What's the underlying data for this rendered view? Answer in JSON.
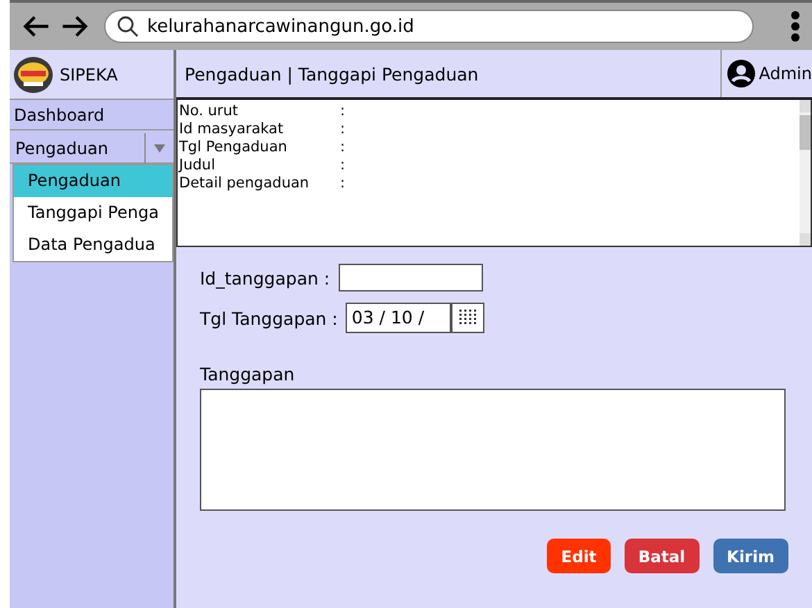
{
  "browser": {
    "url": "kelurahanarcawinangun.go.id"
  },
  "header": {
    "app_name": "SIPEKA",
    "page_title": "Pengaduan | Tanggapi Pengaduan",
    "user": "Admin"
  },
  "sidebar": {
    "items": [
      {
        "label": "Dashboard",
        "kind": "link"
      },
      {
        "label": "Pengaduan",
        "kind": "dropdown",
        "expanded": true,
        "children": [
          {
            "label": "Pengaduan",
            "selected": true
          },
          {
            "label": "Tanggapi Penga",
            "selected": false
          },
          {
            "label": "Data Pengadua",
            "selected": false
          }
        ]
      }
    ]
  },
  "detail": {
    "fields": [
      {
        "label": "No. urut"
      },
      {
        "label": "Id masyarakat"
      },
      {
        "label": "Tgl Pengaduan"
      },
      {
        "label": "Judul"
      },
      {
        "label": "Detail pengaduan"
      }
    ],
    "separator": ":"
  },
  "form": {
    "id_label": "Id_tanggapan :",
    "date_label": "Tgl Tanggapan :",
    "date_value": "03 / 10 /",
    "response_label": "Tanggapan"
  },
  "buttons": [
    {
      "label": "Edit",
      "color": "#ff3300"
    },
    {
      "label": "Batal",
      "color": "#d9343a"
    },
    {
      "label": "Kirim",
      "color": "#3e72b0"
    }
  ]
}
